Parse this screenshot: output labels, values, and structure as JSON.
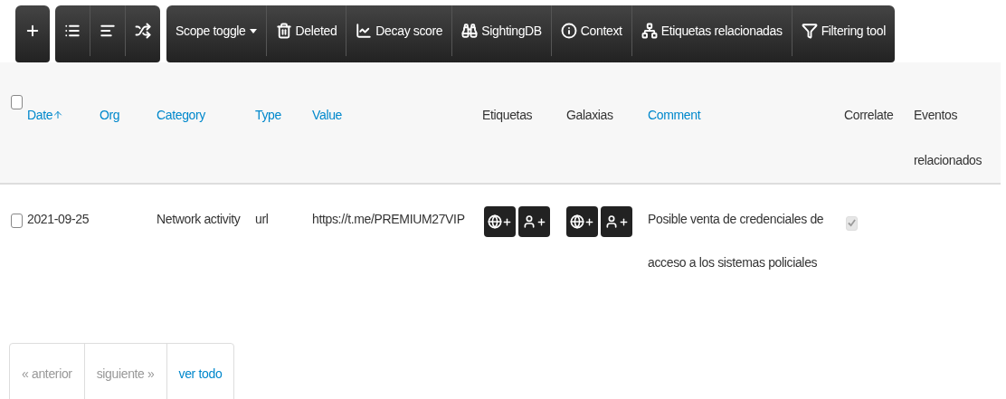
{
  "toolbar": {
    "groups": [
      [
        {
          "kind": "plus"
        }
      ],
      [
        {
          "kind": "list"
        },
        {
          "kind": "align"
        },
        {
          "kind": "shuffle"
        }
      ],
      [
        {
          "kind": "dropdown",
          "label": "Scope toggle"
        },
        {
          "kind": "trash",
          "label": "Deleted"
        },
        {
          "kind": "chart",
          "label": "Decay score"
        },
        {
          "kind": "binoculars",
          "label": "SightingDB"
        },
        {
          "kind": "info",
          "label": "Context"
        },
        {
          "kind": "network",
          "label": "Etiquetas relacionadas"
        },
        {
          "kind": "filter",
          "label": "Filtering tool"
        }
      ]
    ]
  },
  "table": {
    "columns": [
      {
        "label": "Date",
        "link": true,
        "sorted": true
      },
      {
        "label": "Org",
        "link": true,
        "sorted": false
      },
      {
        "label": "Category",
        "link": true,
        "sorted": false
      },
      {
        "label": "Type",
        "link": true,
        "sorted": false
      },
      {
        "label": "Value",
        "link": true,
        "sorted": false
      },
      {
        "label": "Etiquetas",
        "link": false,
        "sorted": false
      },
      {
        "label": "Galaxias",
        "link": false,
        "sorted": false
      },
      {
        "label": "Comment",
        "link": true,
        "sorted": false
      },
      {
        "label": "Correlate",
        "link": false,
        "sorted": false
      },
      {
        "label": "Eventos relacionados",
        "link": false,
        "sorted": false
      }
    ],
    "select_all_checked": false,
    "rows": [
      {
        "checked": false,
        "date": "2021-09-25",
        "category": "Network activity",
        "type": "url",
        "value": "https://t.me/PREMIUM27VIP",
        "comment": "Posible venta de credenciales de acceso a los sistemas policiales",
        "correlate": {
          "checked": true,
          "disabled": true
        }
      }
    ]
  },
  "pagination": [
    {
      "label": "« anterior",
      "disabled": true
    },
    {
      "label": "siguiente »",
      "disabled": true
    },
    {
      "label": "ver todo",
      "disabled": false
    }
  ]
}
